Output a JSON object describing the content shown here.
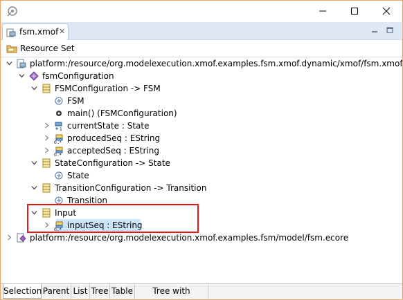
{
  "editor": {
    "tab_label": "fsm.xmof",
    "close_glyph": "✕"
  },
  "resource_set": {
    "label": "Resource Set"
  },
  "tree": [
    {
      "label": "platform:/resource/org.modelexecution.xmof.examples.fsm.xmof.dynamic/xmof/fsm.xmof",
      "depth": 0,
      "twisty": "open",
      "icon": "xmof-file-icon"
    },
    {
      "label": "fsmConfiguration",
      "depth": 1,
      "twisty": "open",
      "icon": "package-icon"
    },
    {
      "label": "FSMConfiguration -> FSM",
      "depth": 2,
      "twisty": "open",
      "icon": "class-icon"
    },
    {
      "label": "FSM",
      "depth": 3,
      "twisty": "none",
      "icon": "supertype-icon"
    },
    {
      "label": "main() (FSMConfiguration)",
      "depth": 3,
      "twisty": "none",
      "icon": "operation-icon"
    },
    {
      "label": "currentState : State",
      "depth": 3,
      "twisty": "closed",
      "icon": "reference-single-icon"
    },
    {
      "label": "producedSeq : EString",
      "depth": 3,
      "twisty": "closed",
      "icon": "attribute-many-icon"
    },
    {
      "label": "acceptedSeq : EString",
      "depth": 3,
      "twisty": "closed",
      "icon": "attribute-many-icon"
    },
    {
      "label": "StateConfiguration -> State",
      "depth": 2,
      "twisty": "open",
      "icon": "class-icon"
    },
    {
      "label": "State",
      "depth": 3,
      "twisty": "none",
      "icon": "supertype-icon"
    },
    {
      "label": "TransitionConfiguration -> Transition",
      "depth": 2,
      "twisty": "open",
      "icon": "class-icon"
    },
    {
      "label": "Transition",
      "depth": 3,
      "twisty": "none",
      "icon": "supertype-icon"
    },
    {
      "label": "Input",
      "depth": 2,
      "twisty": "open",
      "icon": "class-icon"
    },
    {
      "label": "inputSeq : EString",
      "depth": 3,
      "twisty": "closed",
      "icon": "attribute-many-icon",
      "selected": true
    },
    {
      "label": "platform:/resource/org.modelexecution.xmof.examples.fsm/model/fsm.ecore",
      "depth": 0,
      "twisty": "closed",
      "icon": "ecore-file-icon"
    }
  ],
  "bottom_tabs": [
    {
      "label": "Selection",
      "active": true
    },
    {
      "label": "Parent"
    },
    {
      "label": "List"
    },
    {
      "label": "Tree"
    },
    {
      "label": "Table"
    },
    {
      "label": "Tree with Columns"
    }
  ],
  "colors": {
    "selection": "#cce4f7",
    "highlight_box": "#e81818",
    "tab_strip": "#dfe8f4"
  }
}
